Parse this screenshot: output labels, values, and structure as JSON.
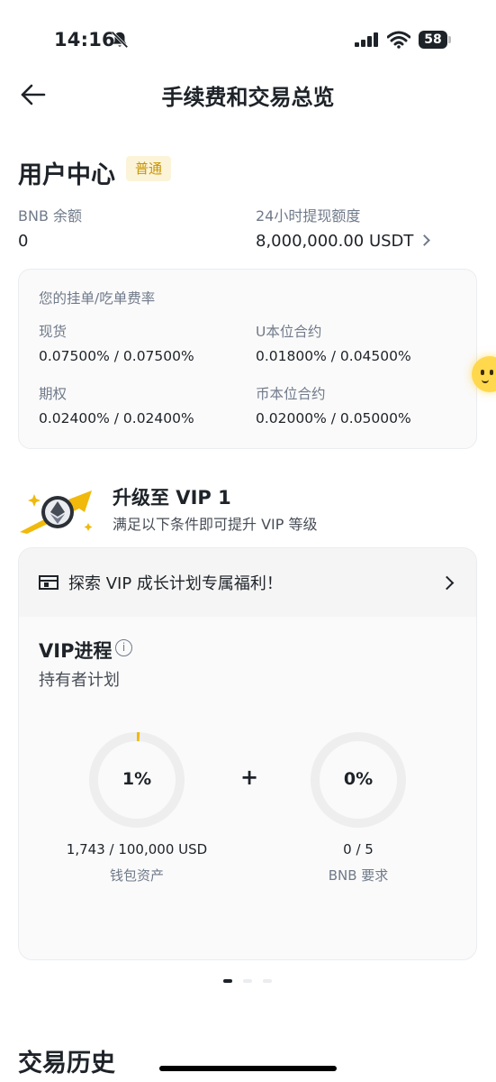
{
  "status_bar": {
    "time": "14:16",
    "battery": "58",
    "icons": [
      "bell-slash-icon",
      "signal-icon",
      "wifi-icon",
      "battery-icon"
    ]
  },
  "header": {
    "title": "手续费和交易总览",
    "back_icon": "arrow-left-icon"
  },
  "user_center": {
    "title": "用户中心",
    "level_badge": "普通",
    "bnb_balance_label": "BNB 余额",
    "bnb_balance_value": "0",
    "withdraw_limit_label": "24小时提现额度",
    "withdraw_limit_value": "8,000,000.00 USDT"
  },
  "fee_card": {
    "title": "您的挂单/吃单费率",
    "items": [
      {
        "label": "现货",
        "value": "0.07500% / 0.07500%"
      },
      {
        "label": "U本位合约",
        "value": "0.01800% / 0.04500%"
      },
      {
        "label": "期权",
        "value": "0.02400% / 0.02400%"
      },
      {
        "label": "币本位合约",
        "value": "0.02000% / 0.05000%"
      }
    ]
  },
  "upgrade": {
    "title": "升级至 VIP 1",
    "subtitle": "满足以下条件即可提升 VIP 等级"
  },
  "vip_card": {
    "explore_text": "探索 VIP 成长计划专属福利！",
    "progress_title": "VIP进程",
    "info_symbol": "i",
    "plan_subtitle": "持有者计划",
    "plus": "+",
    "rings": [
      {
        "percent": "1%",
        "fraction": 0.01,
        "value": "1,743 / 100,000 USD",
        "label": "钱包资产"
      },
      {
        "percent": "0%",
        "fraction": 0,
        "value": "0 / 5",
        "label": "BNB 要求"
      }
    ],
    "colors": {
      "accent": "#f0b90b",
      "track": "#eeeeee"
    }
  },
  "pagination": {
    "count": 3,
    "active": 0
  },
  "history": {
    "title": "交易历史"
  }
}
